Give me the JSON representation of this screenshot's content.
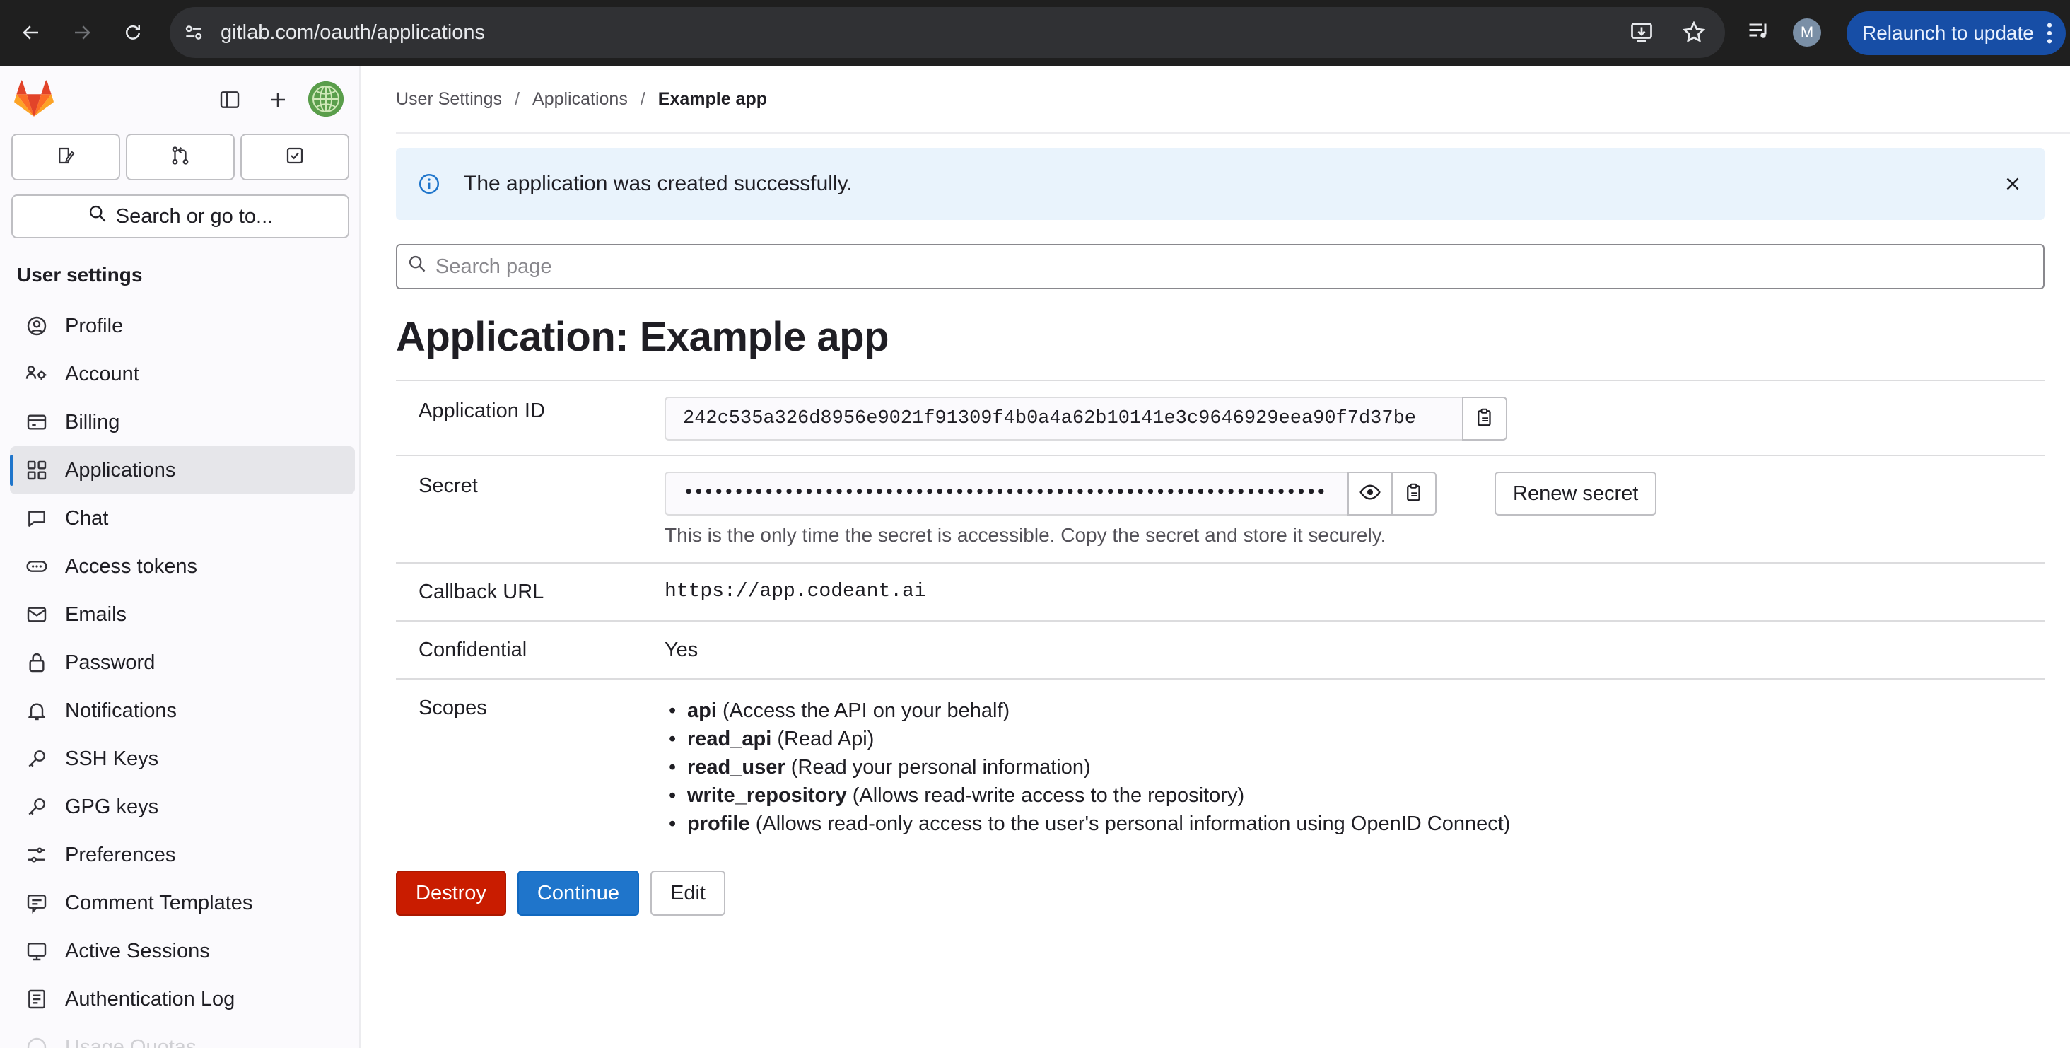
{
  "browser": {
    "url": "gitlab.com/oauth/applications",
    "profile_initial": "M",
    "relaunch_label": "Relaunch to update"
  },
  "sidebar": {
    "search_label": "Search or go to...",
    "heading": "User settings",
    "items": [
      {
        "label": "Profile",
        "icon": "profile-icon"
      },
      {
        "label": "Account",
        "icon": "account-icon"
      },
      {
        "label": "Billing",
        "icon": "billing-icon"
      },
      {
        "label": "Applications",
        "icon": "applications-icon",
        "active": true
      },
      {
        "label": "Chat",
        "icon": "chat-icon"
      },
      {
        "label": "Access tokens",
        "icon": "token-icon"
      },
      {
        "label": "Emails",
        "icon": "mail-icon"
      },
      {
        "label": "Password",
        "icon": "lock-icon"
      },
      {
        "label": "Notifications",
        "icon": "bell-icon"
      },
      {
        "label": "SSH Keys",
        "icon": "key-icon"
      },
      {
        "label": "GPG keys",
        "icon": "key-icon"
      },
      {
        "label": "Preferences",
        "icon": "preferences-icon"
      },
      {
        "label": "Comment Templates",
        "icon": "comment-icon"
      },
      {
        "label": "Active Sessions",
        "icon": "session-icon"
      },
      {
        "label": "Authentication Log",
        "icon": "log-icon"
      },
      {
        "label": "Usage Quotas",
        "icon": "quota-icon"
      }
    ]
  },
  "breadcrumb": {
    "items": [
      "User Settings",
      "Applications"
    ],
    "current": "Example app"
  },
  "alert": {
    "message": "The application was created successfully."
  },
  "page_search": {
    "placeholder": "Search page"
  },
  "page_title": "Application: Example app",
  "details": {
    "app_id_label": "Application ID",
    "app_id_value": "242c535a326d8956e9021f91309f4b0a4a62b10141e3c9646929eea90f7d37be",
    "secret_label": "Secret",
    "secret_masked": "••••••••••••••••••••••••••••••••••••••••••••••••••••••••••••••••",
    "renew_label": "Renew secret",
    "secret_help": "This is the only time the secret is accessible. Copy the secret and store it securely.",
    "callback_label": "Callback URL",
    "callback_value": "https://app.codeant.ai",
    "confidential_label": "Confidential",
    "confidential_value": "Yes",
    "scopes_label": "Scopes",
    "scopes": [
      {
        "name": "api",
        "desc": "(Access the API on your behalf)"
      },
      {
        "name": "read_api",
        "desc": "(Read Api)"
      },
      {
        "name": "read_user",
        "desc": "(Read your personal information)"
      },
      {
        "name": "write_repository",
        "desc": "(Allows read-write access to the repository)"
      },
      {
        "name": "profile",
        "desc": "(Allows read-only access to the user's personal information using OpenID Connect)"
      }
    ]
  },
  "actions": {
    "destroy": "Destroy",
    "continue": "Continue",
    "edit": "Edit"
  },
  "colors": {
    "accent": "#1f75cb",
    "danger": "#c91c00",
    "alert_bg": "#e9f3fc",
    "sidebar_bg": "#fbfafd"
  }
}
